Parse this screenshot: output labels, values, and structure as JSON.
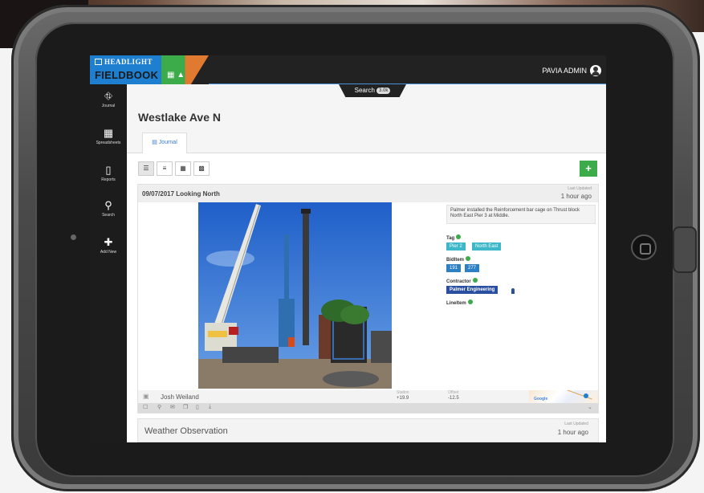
{
  "app": {
    "logo_top": "HEADLIGHT",
    "logo_bottom": "FIELDBOOK",
    "user_name": "PAVIA ADMIN"
  },
  "sidebar": {
    "items": [
      {
        "label": "Journal",
        "icon": "binoculars-icon"
      },
      {
        "label": "Spreadsheets",
        "icon": "grid-icon"
      },
      {
        "label": "Reports",
        "icon": "book-icon"
      },
      {
        "label": "Search",
        "icon": "search-icon"
      },
      {
        "label": "Add New",
        "icon": "plus-icon"
      }
    ]
  },
  "search_tab": {
    "label": "Search",
    "count": "3.0k"
  },
  "page": {
    "title": "Westlake Ave N",
    "tab_journal": "Journal"
  },
  "toolbar": {
    "add_label": "+"
  },
  "entry": {
    "title": "09/07/2017 Looking North",
    "last_updated_label": "Last Updated",
    "last_updated": "1 hour ago",
    "description": "Palmer installed the Reinforcement bar cage on Thrust block North East Pier 3 at Middle.",
    "tag_label": "Tag",
    "tags": [
      "Pier 2",
      "North East"
    ],
    "biditem_label": "BidItem",
    "biditems": [
      "191",
      "277"
    ],
    "contractor_label": "Contractor",
    "contractor": "Palmer Engineering",
    "lineitem_label": "LineItem",
    "author": "Josh Weiland",
    "station_label": "Station",
    "station": "+19.9",
    "offset_label": "Offset",
    "offset": "-12.5",
    "map_brand": "Google"
  },
  "entry2": {
    "title": "Weather Observation",
    "last_updated_label": "Last Updated",
    "last_updated": "1 hour ago"
  },
  "colors": {
    "accent": "#1e7fd0",
    "add_green": "#3cab4a",
    "tag_teal": "#3eb7c9",
    "biditem_blue": "#2d80c4",
    "contractor_navy": "#2a4fa0"
  }
}
